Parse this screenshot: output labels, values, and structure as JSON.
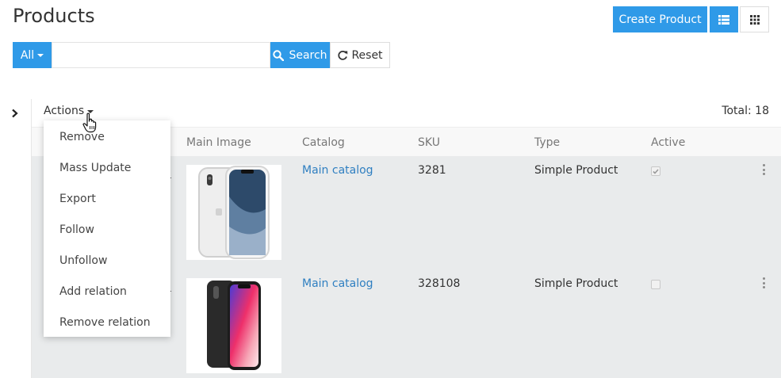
{
  "page": {
    "title": "Products"
  },
  "toolbar": {
    "create_label": "Create Product",
    "list_view_icon": "list-icon",
    "grid_view_icon": "grid-icon"
  },
  "search": {
    "scope_label": "All",
    "value": "",
    "placeholder": "",
    "search_label": "Search",
    "reset_label": "Reset"
  },
  "list": {
    "actions_label": "Actions",
    "total_label": "Total: 18",
    "columns": [
      "Main Image",
      "Catalog",
      "SKU",
      "Type",
      "Active"
    ],
    "rows": [
      {
        "catalog": "Main catalog",
        "sku": "3281",
        "type": "Simple Product",
        "active": true,
        "image": "iphone-xr-white"
      },
      {
        "catalog": "Main catalog",
        "sku": "328108",
        "type": "Simple Product",
        "active": false,
        "image": "iphone-x-black"
      }
    ]
  },
  "actions_menu": {
    "items": [
      "Remove",
      "Mass Update",
      "Export",
      "Follow",
      "Unfollow",
      "Add relation",
      "Remove relation"
    ]
  },
  "colors": {
    "primary": "#2f9ae8",
    "link": "#2f7fc1",
    "row_bg": "#e9ebec"
  }
}
